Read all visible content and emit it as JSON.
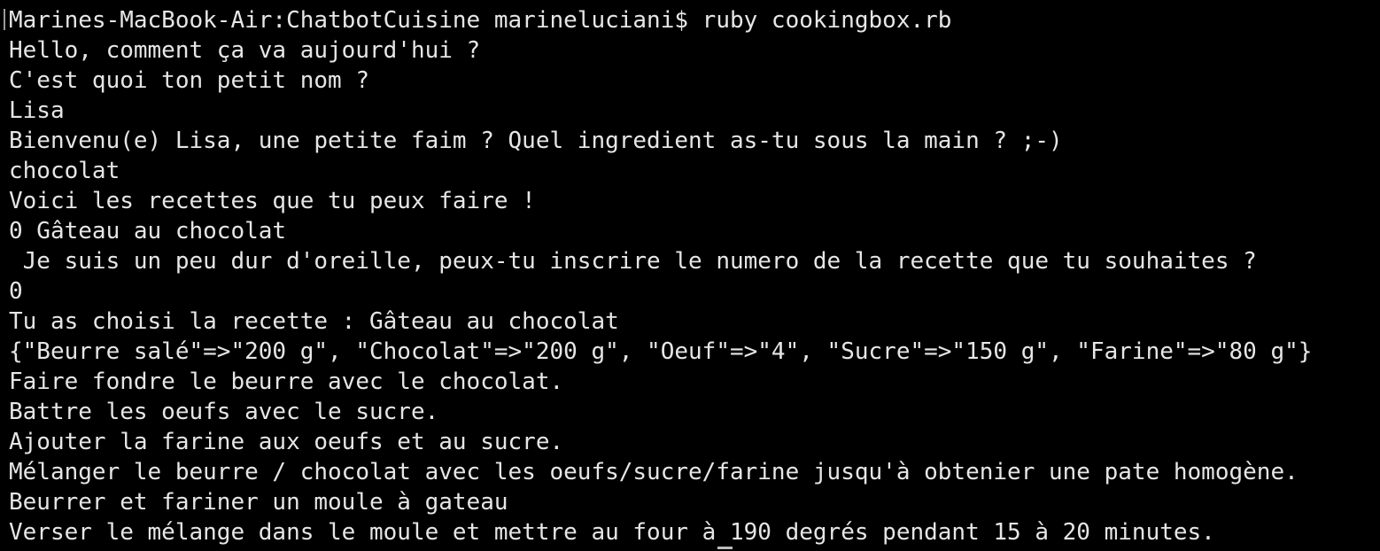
{
  "terminal": {
    "clipped_top_line": "- - - - - - - - - - - - - - - - - - - - - - - - - - - - - - - - - -",
    "lines": [
      "Marines-MacBook-Air:ChatbotCuisine marineluciani$ ruby cookingbox.rb",
      "Hello, comment ça va aujourd'hui ?",
      "C'est quoi ton petit nom ?",
      "Lisa",
      "Bienvenu(e) Lisa, une petite faim ? Quel ingredient as-tu sous la main ? ;-)",
      "chocolat",
      "Voici les recettes que tu peux faire !",
      "0 Gâteau au chocolat",
      " Je suis un peu dur d'oreille, peux-tu inscrire le numero de la recette que tu souhaites ?",
      "0",
      "Tu as choisi la recette : Gâteau au chocolat",
      "{\"Beurre salé\"=>\"200 g\", \"Chocolat\"=>\"200 g\", \"Oeuf\"=>\"4\", \"Sucre\"=>\"150 g\", \"Farine\"=>\"80 g\"}",
      "Faire fondre le beurre avec le chocolat.",
      "Battre les oeufs avec le sucre.",
      "Ajouter la farine aux oeufs et au sucre.",
      "Mélanger le beurre / chocolat avec les oeufs/sucre/farine jusqu'à obtenier une pate homogène.",
      "Beurrer et fariner un moule à gateau",
      "Verser le mélange dans le moule et mettre au four à 190 degrés pendant 15 à 20 minutes."
    ]
  },
  "colors": {
    "background": "#000000",
    "text": "#e6e6e6"
  }
}
